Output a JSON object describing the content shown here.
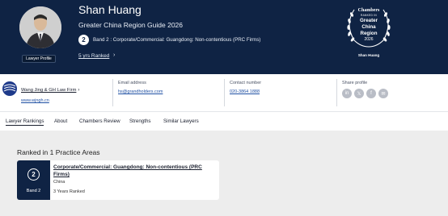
{
  "header": {
    "name": "Shan Huang",
    "guide": "Greater China Region Guide 2026",
    "band_number": "2",
    "band_text": "Band 2 : Corporate/Commercial: Guangdong: Non-contentious (PRC Firms)",
    "years_ranked_link": "5 yrs Ranked",
    "chevron": "›",
    "profile_badge": "Lawyer Profile",
    "background_color": "#0f2344"
  },
  "award": {
    "brand": "Chambers",
    "ranked_in": "RANKED IN",
    "region_line1": "Greater",
    "region_line2": "China",
    "region_line3": "Region",
    "year": "2026",
    "name": "Shan Huang"
  },
  "info": {
    "firm_name": "Wang Jing & GH Law Firm",
    "firm_chevron": "›",
    "firm_url": "www.wjngh.cn",
    "email_label": "Email address",
    "email_value": "hs@grandholders.com",
    "phone_label": "Contact number",
    "phone_value": "020-3864 1888",
    "share_label": "Share profile",
    "share_icons": [
      "linkedin-icon",
      "x-icon",
      "facebook-icon",
      "email-icon"
    ]
  },
  "tabs": [
    {
      "label": "Lawyer Rankings",
      "active": true
    },
    {
      "label": "About",
      "active": false
    },
    {
      "label": "Chambers Review",
      "active": false
    },
    {
      "label": "Strengths",
      "active": false
    },
    {
      "label": "Similar Lawyers",
      "active": false
    }
  ],
  "rankings": {
    "title": "Ranked in 1 Practice Areas",
    "card": {
      "band_number": "2",
      "band_label": "Band 2",
      "practice_area": "Corporate/Commercial: Guangdong: Non-contentious (PRC Firms)",
      "location": "China",
      "years": "3 Years Ranked"
    }
  }
}
